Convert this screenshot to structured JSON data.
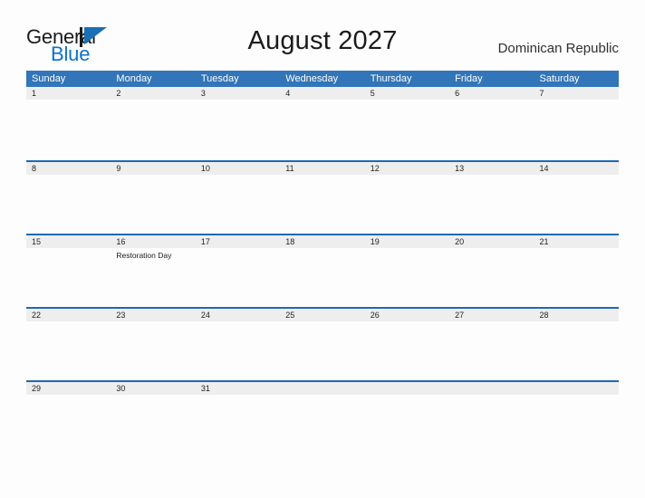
{
  "brand": {
    "name_part1": "General",
    "name_part2": "Blue",
    "mark_icon": "blue-triangle-flag-icon",
    "color_dark": "#1b1b1b",
    "color_blue": "#0d72c8"
  },
  "header": {
    "title": "August 2027",
    "region": "Dominican Republic"
  },
  "colors": {
    "header_blue": "#3275b8",
    "row_divider_blue": "#1f6ab0",
    "date_band_gray": "#eeeeee",
    "page_background": "#fdfdfd",
    "text_dark": "#222222"
  },
  "calendar": {
    "month": "August",
    "year": "2027",
    "weekday_headers": [
      "Sunday",
      "Monday",
      "Tuesday",
      "Wednesday",
      "Thursday",
      "Friday",
      "Saturday"
    ],
    "weeks": [
      {
        "days": [
          {
            "date": "1",
            "events": []
          },
          {
            "date": "2",
            "events": []
          },
          {
            "date": "3",
            "events": []
          },
          {
            "date": "4",
            "events": []
          },
          {
            "date": "5",
            "events": []
          },
          {
            "date": "6",
            "events": []
          },
          {
            "date": "7",
            "events": []
          }
        ]
      },
      {
        "days": [
          {
            "date": "8",
            "events": []
          },
          {
            "date": "9",
            "events": []
          },
          {
            "date": "10",
            "events": []
          },
          {
            "date": "11",
            "events": []
          },
          {
            "date": "12",
            "events": []
          },
          {
            "date": "13",
            "events": []
          },
          {
            "date": "14",
            "events": []
          }
        ]
      },
      {
        "days": [
          {
            "date": "15",
            "events": []
          },
          {
            "date": "16",
            "events": [
              "Restoration Day"
            ]
          },
          {
            "date": "17",
            "events": []
          },
          {
            "date": "18",
            "events": []
          },
          {
            "date": "19",
            "events": []
          },
          {
            "date": "20",
            "events": []
          },
          {
            "date": "21",
            "events": []
          }
        ]
      },
      {
        "days": [
          {
            "date": "22",
            "events": []
          },
          {
            "date": "23",
            "events": []
          },
          {
            "date": "24",
            "events": []
          },
          {
            "date": "25",
            "events": []
          },
          {
            "date": "26",
            "events": []
          },
          {
            "date": "27",
            "events": []
          },
          {
            "date": "28",
            "events": []
          }
        ]
      },
      {
        "days": [
          {
            "date": "29",
            "events": []
          },
          {
            "date": "30",
            "events": []
          },
          {
            "date": "31",
            "events": []
          },
          {
            "date": "",
            "events": []
          },
          {
            "date": "",
            "events": []
          },
          {
            "date": "",
            "events": []
          },
          {
            "date": "",
            "events": []
          }
        ]
      }
    ]
  }
}
